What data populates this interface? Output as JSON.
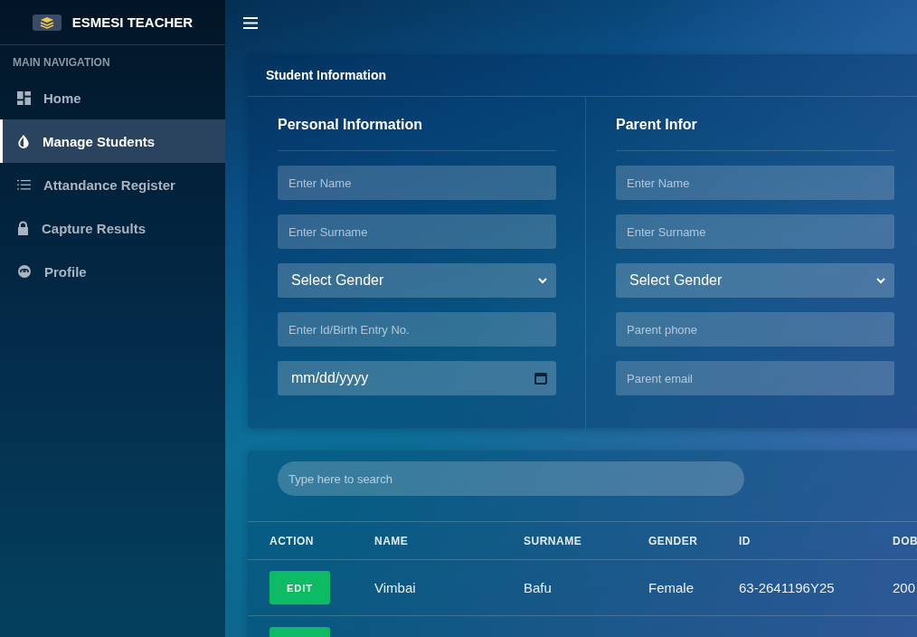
{
  "brand": {
    "title": "ESMESI TEACHER"
  },
  "sidebar": {
    "heading": "MAIN NAVIGATION",
    "items": [
      {
        "label": "Home",
        "selected": false
      },
      {
        "label": "Manage Students",
        "selected": true
      },
      {
        "label": "Attandance Register",
        "selected": false
      },
      {
        "label": "Capture Results",
        "selected": false
      },
      {
        "label": "Profile",
        "selected": false
      }
    ]
  },
  "form_card": {
    "title": "Student Information",
    "sections": [
      {
        "title": "Personal Information",
        "fields": [
          {
            "kind": "text",
            "placeholder": "Enter Name"
          },
          {
            "kind": "text",
            "placeholder": "Enter Surname"
          },
          {
            "kind": "select",
            "value": "Select Gender"
          },
          {
            "kind": "text",
            "placeholder": "Enter Id/Birth Entry No."
          },
          {
            "kind": "date",
            "value": "mm/dd/yyyy"
          }
        ]
      },
      {
        "title": "Parent Infor",
        "fields": [
          {
            "kind": "text",
            "placeholder": "Enter Name"
          },
          {
            "kind": "text",
            "placeholder": "Enter Surname"
          },
          {
            "kind": "select",
            "value": "Select Gender"
          },
          {
            "kind": "text",
            "placeholder": "Parent phone"
          },
          {
            "kind": "text",
            "placeholder": "Parent email"
          }
        ]
      }
    ]
  },
  "table": {
    "search": {
      "placeholder": "Type here to search"
    },
    "columns": [
      "ACTION",
      "NAME",
      "SURNAME",
      "GENDER",
      "ID",
      "DOB"
    ],
    "rows": [
      {
        "kind": "full",
        "cells": [
          "EDIT",
          "Vimbai",
          "Bafu",
          "Female",
          "63-2641196Y25",
          "200"
        ]
      },
      {
        "kind": "cut"
      }
    ]
  }
}
